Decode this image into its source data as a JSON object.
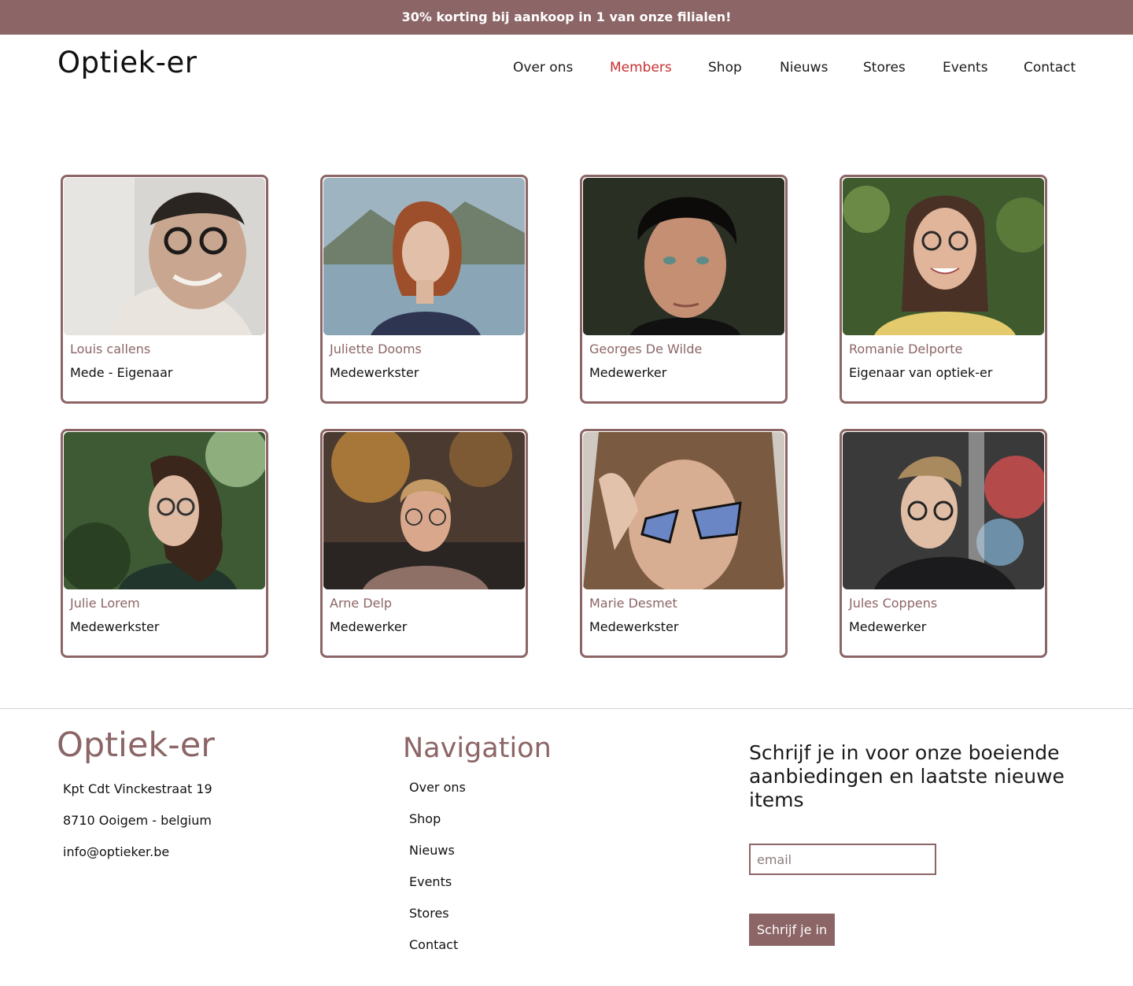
{
  "promo": {
    "text": "30% korting bij aankoop in 1 van onze filialen!"
  },
  "header": {
    "logo": "Optiek-er",
    "nav": [
      {
        "label": "Over ons",
        "active": false
      },
      {
        "label": "Members",
        "active": true
      },
      {
        "label": "Shop",
        "active": false
      },
      {
        "label": "Nieuws",
        "active": false
      },
      {
        "label": "Stores",
        "active": false
      },
      {
        "label": "Events",
        "active": false
      },
      {
        "label": "Contact",
        "active": false
      }
    ]
  },
  "members": [
    {
      "name": "Louis callens",
      "role": "Mede - Eigenaar"
    },
    {
      "name": "Juliette Dooms",
      "role": "Medewerkster"
    },
    {
      "name": "Georges De Wilde",
      "role": "Medewerker"
    },
    {
      "name": "Romanie Delporte",
      "role": "Eigenaar van optiek-er"
    },
    {
      "name": "Julie Lorem",
      "role": "Medewerkster"
    },
    {
      "name": "Arne Delp",
      "role": "Medewerker"
    },
    {
      "name": "Marie Desmet",
      "role": "Medewerkster"
    },
    {
      "name": "Jules Coppens",
      "role": "Medewerker"
    }
  ],
  "footer": {
    "logo": "Optiek-er",
    "address": [
      "Kpt Cdt Vinckestraat 19",
      "8710 Ooigem - belgium",
      "info@optieker.be"
    ],
    "nav_title": "Navigation",
    "nav_links": [
      "Over ons",
      "Shop",
      "Nieuws",
      "Events",
      "Stores",
      "Contact"
    ],
    "newsletter_title": "Schrijf je in voor onze boeiende aanbiedingen en laatste nieuwe items",
    "email_placeholder": "email",
    "subscribe_label": "Schrijf je in"
  },
  "colors": {
    "accent": "#8c6566",
    "active_nav": "#c62f2f"
  }
}
